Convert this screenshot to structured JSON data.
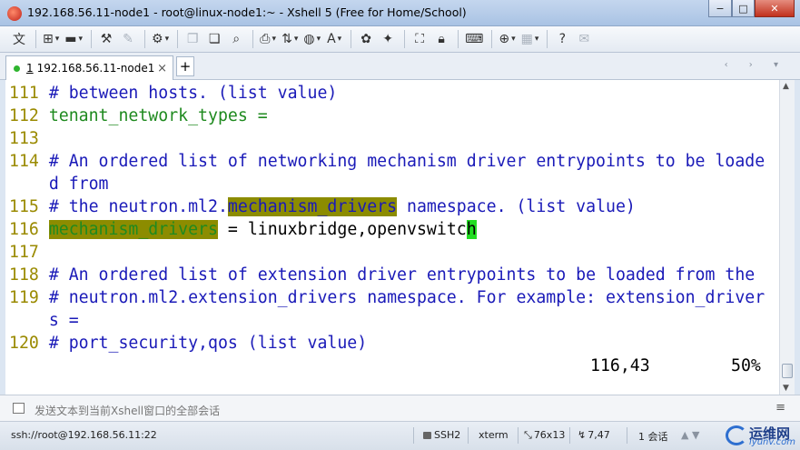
{
  "window": {
    "title": "192.168.56.11-node1 - root@linux-node1:~ - Xshell 5 (Free for Home/School)",
    "controls": {
      "minimize": "−",
      "maximize": "□",
      "close": "✕"
    }
  },
  "toolbar": {
    "items": [
      "文",
      "new-session-icon",
      "open-folder-icon",
      "reconnect-icon",
      "disconnect-icon",
      "properties-icon",
      "copy-icon",
      "paste-icon",
      "find-icon",
      "print-icon",
      "transfer-icon",
      "globe-icon",
      "font-icon",
      "xftp-icon",
      "xmanager-icon",
      "fullscreen-icon",
      "lock-icon",
      "keyboard-icon",
      "add-icon",
      "layout-icon",
      "help-icon",
      "chat-icon"
    ],
    "lang_label": "文"
  },
  "tabs": [
    {
      "number": "1",
      "label": "192.168.56.11-node1",
      "active": true,
      "status_color": "#2fb52f"
    }
  ],
  "tabbar": {
    "new_tab": "+",
    "close": "×",
    "nav": "‹ › ▾"
  },
  "terminal": {
    "lines": [
      {
        "num": "111",
        "text": "# between hosts. (list value)"
      },
      {
        "num": "112",
        "text": "tenant_network_types ="
      },
      {
        "num": "113",
        "text": ""
      },
      {
        "num": "114",
        "text": "# An ordered list of networking mechanism driver entrypoints to be loade"
      },
      {
        "num": "",
        "text": "d from"
      },
      {
        "num": "115",
        "pre": "# the neutron.ml2.",
        "hl": "mechanism_drivers",
        "post": " namespace. (list value)"
      },
      {
        "num": "116",
        "hl": "mechanism_drivers",
        "mid": " = linuxbridge,openvswitc",
        "cursor": "h"
      },
      {
        "num": "117",
        "text": ""
      },
      {
        "num": "118",
        "text": "# An ordered list of extension driver entrypoints to be loaded from the"
      },
      {
        "num": "119",
        "text": "# neutron.ml2.extension_drivers namespace. For example: extension_driver"
      },
      {
        "num": "",
        "text": "s ="
      },
      {
        "num": "120",
        "text": "# port_security,qos (list value)"
      }
    ],
    "status_position": "116,43",
    "status_percent": "50%"
  },
  "compose": {
    "placeholder": "发送文本到当前Xshell窗口的全部会话",
    "menu": "≡"
  },
  "statusbar": {
    "connection": "ssh://root@192.168.56.11:22",
    "protocol": "SSH2",
    "terminal_type": "xterm",
    "size": "76x13",
    "cursor": "7,47",
    "sessions": "1 会话",
    "nav": "▲ ▼"
  },
  "watermark": {
    "line1": "运维网",
    "line2": "iyunv.com"
  },
  "colors": {
    "line_number": "#9a8a00",
    "comment": "#1a1ab8",
    "keyword": "#1f8a1f",
    "search_highlight": "#8c8c00",
    "cursor": "#22dd22"
  }
}
